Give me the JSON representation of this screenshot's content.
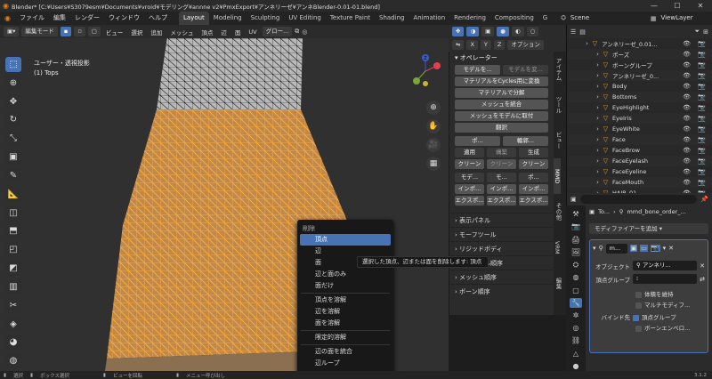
{
  "titlebar": {
    "title": "Blender* [C:¥Users¥S3079esm¥Documents¥vroid¥モデリング¥annne v2¥PmxExport¥アンネリーゼ¥アンネBlender-0.01-01.blend]",
    "min": "—",
    "max": "☐",
    "close": "✕"
  },
  "menu": {
    "file": "ファイル",
    "edit": "編集",
    "render": "レンダー",
    "window": "ウィンドウ",
    "help": "ヘルプ"
  },
  "workspaces": [
    "Layout",
    "Modeling",
    "Sculpting",
    "UV Editing",
    "Texture Paint",
    "Shading",
    "Animation",
    "Rendering",
    "Compositing",
    "G"
  ],
  "scene": {
    "label": "Scene",
    "viewlayer": "ViewLayer"
  },
  "viewheader": {
    "mode": "編集モード",
    "view": "ビュー",
    "select": "選択",
    "add": "追加",
    "mesh": "メッシュ",
    "vertex": "頂点",
    "edge": "辺",
    "face": "面",
    "uv": "UV",
    "global": "グロー...",
    "options": "オプション"
  },
  "viewport": {
    "view_name": "ユーザー・透視投影",
    "object": "(1) Tops"
  },
  "gizmo": {
    "z": "Z",
    "y": "Y",
    "x": "X"
  },
  "npanel": {
    "operator_title": "オペレーター",
    "tab_model": "モデルを...",
    "tab_model2": "モデルを変...",
    "btn_cycles": "マテリアルをCycles用に変換",
    "btn_split": "マテリアルで分解",
    "btn_merge": "メッシュを統合",
    "btn_attach": "メッシュをモデルに取付",
    "btn_translate": "翻訳",
    "pose": "ポ...",
    "outline": "輪郭...",
    "apply": "適用",
    "clean": "クリーン",
    "build": "構築",
    "clean2": "クリーン",
    "generate": "生成",
    "clean3": "クリーン",
    "model": "モデ...",
    "mo": "モ...",
    "po": "ポ...",
    "import1": "インポ...",
    "import2": "インポ...",
    "import3": "インポ...",
    "export1": "エクスポ...",
    "export2": "エクスポ...",
    "export3": "エクスポ...",
    "display_panel": "表示パネル",
    "morph_tool": "モーフツール",
    "rigidbody": "リジッドボディ",
    "material_order": "マテリアル順序",
    "mesh_order": "メッシュ順序",
    "bone_order": "ボーン順序"
  },
  "ntabs": [
    "アイテム",
    "ツール",
    "ビュー",
    "MMD",
    "その他",
    "VRM",
    "編集"
  ],
  "context_menu": {
    "title": "削除",
    "items": [
      "頂点",
      "辺",
      "面",
      "辺と面のみ",
      "面だけ",
      "頂点を溶解",
      "辺を溶解",
      "面を溶解",
      "限定的溶解",
      "辺の面を統合",
      "辺ループ"
    ]
  },
  "tooltip": "選択した頂点、辺または面を削除します: 頂点",
  "outliner": {
    "items": [
      {
        "name": "アンネリーゼ_0.01...",
        "indent": 1
      },
      {
        "name": "ポーズ",
        "indent": 2
      },
      {
        "name": "ボーングループ",
        "indent": 2
      },
      {
        "name": "アンネリーゼ_0...",
        "indent": 2
      },
      {
        "name": "Body",
        "indent": 2
      },
      {
        "name": "Bottoms",
        "indent": 2
      },
      {
        "name": "EyeHighlight",
        "indent": 2
      },
      {
        "name": "EyeIris",
        "indent": 2
      },
      {
        "name": "EyeWhite",
        "indent": 2
      },
      {
        "name": "Face",
        "indent": 2
      },
      {
        "name": "FaceBrow",
        "indent": 2
      },
      {
        "name": "FaceEyelash",
        "indent": 2
      },
      {
        "name": "FaceEyeline",
        "indent": 2
      },
      {
        "name": "FaceMouth",
        "indent": 2
      },
      {
        "name": "HAIR_01",
        "indent": 2
      }
    ]
  },
  "properties": {
    "breadcrumb_obj": "To...",
    "breadcrumb_mod": "mmd_bone_order_...",
    "add_modifier": "モディファイアーを追加",
    "modifier_name": "m...",
    "object_label": "オブジェクト",
    "object_value": "アンネリ...",
    "vgroup_label": "頂点グループ",
    "preserve_volume": "体積を維持",
    "multi_modifier": "マルチモディフ...",
    "bind_label": "バインド先",
    "vertex_groups": "頂点グループ",
    "bone_envelope": "ボーンエンベロ..."
  },
  "statusbar": {
    "select": "選択",
    "box_select": "ボックス選択",
    "rotate": "ビューを回転",
    "menu": "メニュー呼び出し",
    "version": "3.1.2"
  },
  "colors": {
    "accent": "#4772b3",
    "selected_wire": "#ff9d28",
    "viewport_bg": "#303030"
  }
}
